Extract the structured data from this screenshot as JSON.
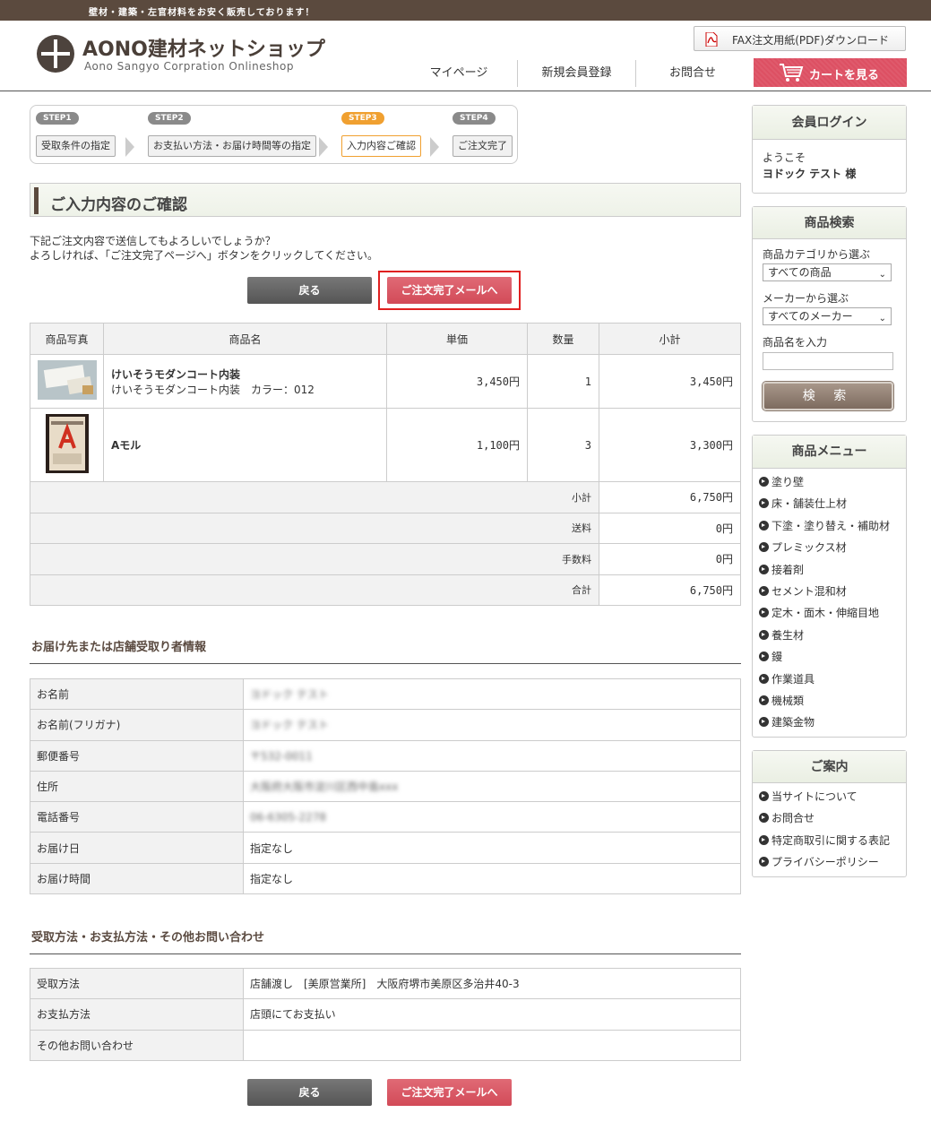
{
  "topbar": {
    "tagline": "壁材・建築・左官材料をお安く販売しております！"
  },
  "header": {
    "logo_title": "AONO建材ネットショップ",
    "logo_subtitle": "Aono Sangyo  Corpration  Onlineshop",
    "fax_download": "FAX注文用紙(PDF)ダウンロード",
    "nav": [
      "マイページ",
      "新規会員登録",
      "お問合せ"
    ],
    "cart": "カートを見る"
  },
  "steps": [
    {
      "tag": "STEP1",
      "label": "受取条件の指定"
    },
    {
      "tag": "STEP2",
      "label": "お支払い方法・お届け時間等の指定"
    },
    {
      "tag": "STEP3",
      "label": "入力内容ご確認"
    },
    {
      "tag": "STEP4",
      "label": "ご注文完了"
    }
  ],
  "page_title": "ご入力内容のご確認",
  "intro": {
    "line1": "下記ご注文内容で送信してもよろしいでしょうか？",
    "line2": "よろしければ、「ご注文完了ページへ」ボタンをクリックしてください。"
  },
  "buttons": {
    "back": "戻る",
    "complete": "ご注文完了メールへ"
  },
  "cart_table": {
    "headers": [
      "商品写真",
      "商品名",
      "単価",
      "数量",
      "小計"
    ],
    "items": [
      {
        "name": "けいそうモダンコート内装",
        "detail": "けいそうモダンコート内装　カラー：012",
        "price": "3,450円",
        "qty": "1",
        "subtotal": "3,450円"
      },
      {
        "name": "Aモル",
        "detail": "",
        "price": "1,100円",
        "qty": "3",
        "subtotal": "3,300円"
      }
    ],
    "summary": [
      {
        "label": "小計",
        "value": "6,750円"
      },
      {
        "label": "送料",
        "value": "0円"
      },
      {
        "label": "手数料",
        "value": "0円"
      },
      {
        "label": "合計",
        "value": "6,750円"
      }
    ]
  },
  "delivery": {
    "heading": "お届け先または店舗受取り者情報",
    "rows": [
      {
        "key": "お名前",
        "value": "ヨドック テスト"
      },
      {
        "key": "お名前(フリガナ)",
        "value": "ヨドック テスト"
      },
      {
        "key": "郵便番号",
        "value": "〒532-0011"
      },
      {
        "key": "住所",
        "value": "大阪府大阪市淀川区西中島xxx"
      },
      {
        "key": "電話番号",
        "value": "06-6305-2278"
      },
      {
        "key": "お届け日",
        "value": "指定なし"
      },
      {
        "key": "お届け時間",
        "value": "指定なし"
      }
    ]
  },
  "payment": {
    "heading": "受取方法・お支払方法・その他お問い合わせ",
    "rows": [
      {
        "key": "受取方法",
        "value": "店舗渡し　[美原営業所]　大阪府堺市美原区多治井40-3"
      },
      {
        "key": "お支払方法",
        "value": "店頭にてお支払い"
      },
      {
        "key": "その他お問い合わせ",
        "value": ""
      }
    ]
  },
  "sidebar": {
    "login": {
      "title": "会員ログイン",
      "welcome": "ようこそ",
      "user": "ヨドック テスト 様"
    },
    "search": {
      "title": "商品検索",
      "category_label": "商品カテゴリから選ぶ",
      "category_value": "すべての商品",
      "maker_label": "メーカーから選ぶ",
      "maker_value": "すべてのメーカー",
      "name_label": "商品名を入力",
      "button": "検 索"
    },
    "menu": {
      "title": "商品メニュー",
      "items": [
        "塗り壁",
        "床・舗装仕上材",
        "下塗・塗り替え・補助材",
        "プレミックス材",
        "接着剤",
        "セメント混和材",
        "定木・面木・伸縮目地",
        "養生材",
        "鏝",
        "作業道具",
        "機械類",
        "建築金物"
      ]
    },
    "guide": {
      "title": "ご案内",
      "items": [
        "当サイトについて",
        "お問合せ",
        "特定商取引に関する表記",
        "プライバシーポリシー"
      ]
    }
  }
}
